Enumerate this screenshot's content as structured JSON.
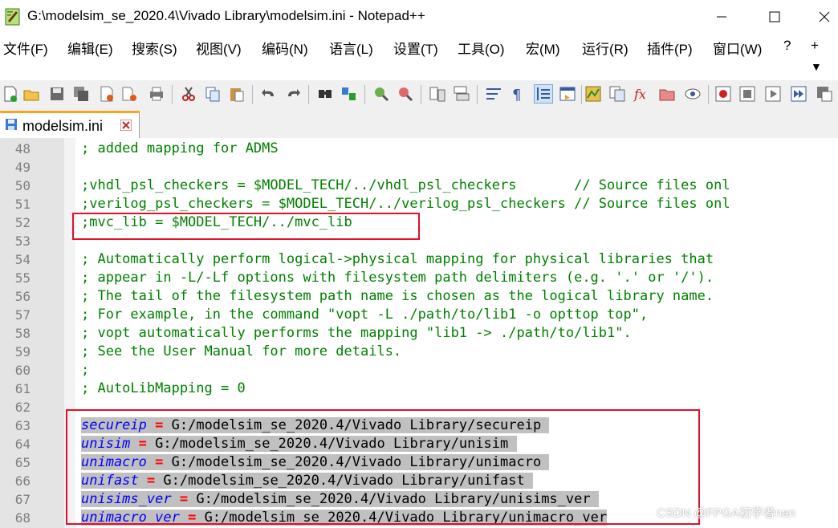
{
  "window": {
    "title": "G:\\modelsim_se_2020.4\\Vivado Library\\modelsim.ini - Notepad++",
    "controls": [
      "minimize-icon",
      "maximize-icon",
      "close-icon"
    ]
  },
  "menu": {
    "items": [
      "文件(F)",
      "编辑(E)",
      "搜索(S)",
      "视图(V)",
      "编码(N)",
      "语言(L)",
      "设置(T)",
      "工具(O)",
      "宏(M)",
      "运行(R)",
      "插件(P)",
      "窗口(W)",
      "?",
      "+"
    ],
    "more": "▼"
  },
  "toolbar": {
    "icons": [
      "new-file-icon",
      "open-file-icon",
      "save-icon",
      "save-all-icon",
      "close-icon",
      "close-all-icon",
      "print-icon",
      "cut-icon",
      "copy-icon",
      "paste-icon",
      "undo-icon",
      "redo-icon",
      "find-icon",
      "replace-icon",
      "zoom-in-icon",
      "zoom-out-icon",
      "sync-vertical-icon",
      "sync-horizontal-icon",
      "word-wrap-icon",
      "show-all-chars-icon",
      "indent-guide-icon",
      "user-language-icon",
      "doc-map-icon",
      "doc-list-icon",
      "function-list-icon",
      "folder-workspace-icon",
      "monitoring-icon",
      "record-macro-icon",
      "stop-record-icon",
      "playback-icon",
      "run-macro-multiple-icon",
      "save-macro-icon"
    ]
  },
  "tab": {
    "label": "modelsim.ini",
    "accent": "#f5a623"
  },
  "editor": {
    "lines": [
      {
        "n": "48",
        "type": "comment",
        "text": "; added mapping for ADMS"
      },
      {
        "n": "49",
        "type": "blank",
        "text": ""
      },
      {
        "n": "50",
        "type": "comment",
        "text": ";vhdl_psl_checkers = $MODEL_TECH/../vhdl_psl_checkers       // Source files onl"
      },
      {
        "n": "51",
        "type": "comment",
        "text": ";verilog_psl_checkers = $MODEL_TECH/../verilog_psl_checkers // Source files onl"
      },
      {
        "n": "52",
        "type": "comment",
        "text": ";mvc_lib = $MODEL_TECH/../mvc_lib"
      },
      {
        "n": "53",
        "type": "blank",
        "text": ""
      },
      {
        "n": "54",
        "type": "comment",
        "text": "; Automatically perform logical->physical mapping for physical libraries that"
      },
      {
        "n": "55",
        "type": "comment",
        "text": "; appear in -L/-Lf options with filesystem path delimiters (e.g. '.' or '/')."
      },
      {
        "n": "56",
        "type": "comment",
        "text": "; The tail of the filesystem path name is chosen as the logical library name."
      },
      {
        "n": "57",
        "type": "comment",
        "text": "; For example, in the command \"vopt -L ./path/to/lib1 -o opttop top\","
      },
      {
        "n": "58",
        "type": "comment",
        "text": "; vopt automatically performs the mapping \"lib1 -> ./path/to/lib1\"."
      },
      {
        "n": "59",
        "type": "comment",
        "text": "; See the User Manual for more details."
      },
      {
        "n": "60",
        "type": "comment",
        "text": ";"
      },
      {
        "n": "61",
        "type": "comment",
        "text": "; AutoLibMapping = 0"
      },
      {
        "n": "62",
        "type": "blank",
        "text": ""
      },
      {
        "n": "63",
        "type": "kv",
        "key": "secureip",
        "eq": "=",
        "value": " G:/modelsim_se_2020.4/Vivado Library/secureip "
      },
      {
        "n": "64",
        "type": "kv",
        "key": "unisim",
        "eq": "=",
        "value": " G:/modelsim_se_2020.4/Vivado Library/unisim "
      },
      {
        "n": "65",
        "type": "kv",
        "key": "unimacro",
        "eq": "=",
        "value": " G:/modelsim_se_2020.4/Vivado Library/unimacro "
      },
      {
        "n": "66",
        "type": "kv",
        "key": "unifast",
        "eq": "=",
        "value": " G:/modelsim_se_2020.4/Vivado Library/unifast "
      },
      {
        "n": "67",
        "type": "kv",
        "key": "unisims_ver",
        "eq": "=",
        "value": " G:/modelsim_se_2020.4/Vivado Library/unisims_ver "
      },
      {
        "n": "68",
        "type": "kv",
        "key": "unimacro_ver",
        "eq": "=",
        "value": " G:/modelsim_se_2020.4/Vivado Library/unimacro_ver"
      }
    ]
  },
  "watermark": "CSDN @FPGA初学者nan",
  "colors": {
    "comment": "#008000",
    "key": "#0000ff",
    "operator": "#ff0000",
    "highlight_box": "#e0102a"
  }
}
